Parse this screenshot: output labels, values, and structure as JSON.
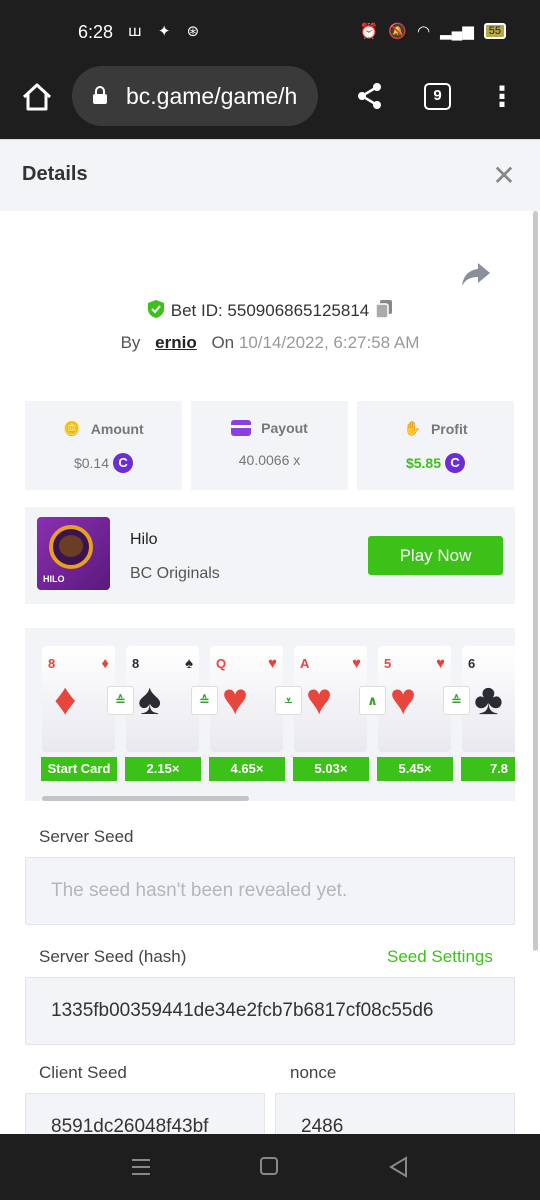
{
  "status_bar": {
    "time": "6:28",
    "app_icons": "ꟺ ✦ ⊛",
    "battery": "55"
  },
  "browser": {
    "url": "bc.game/game/h",
    "tab_count": "9"
  },
  "modal": {
    "title": "Details"
  },
  "bet": {
    "bet_id_text": "Bet ID: 550906865125814",
    "by_label": "By",
    "username": "ernio",
    "on_label": "On",
    "date": "10/14/2022, 6:27:58 AM"
  },
  "stats": {
    "amount_label": "Amount",
    "amount_value": "$0.14",
    "payout_label": "Payout",
    "payout_value": "40.0066 x",
    "profit_label": "Profit",
    "profit_value": "$5.85",
    "coin_symbol": "C"
  },
  "game": {
    "name": "Hilo",
    "provider": "BC Originals",
    "play_label": "Play Now",
    "thumb_text": "HILO"
  },
  "cards": [
    {
      "rank": "8",
      "suit": "♦",
      "color": "#e8453c",
      "mult": "Start Card",
      "arrow": ""
    },
    {
      "rank": "8",
      "suit": "♠",
      "color": "#2b2b33",
      "mult": "2.15×",
      "arrow": "≙"
    },
    {
      "rank": "Q",
      "suit": "♥",
      "color": "#e8453c",
      "mult": "4.65×",
      "arrow": "≙"
    },
    {
      "rank": "A",
      "suit": "♥",
      "color": "#e8453c",
      "mult": "5.03×",
      "arrow": "⩡"
    },
    {
      "rank": "5",
      "suit": "♥",
      "color": "#e8453c",
      "mult": "5.45×",
      "arrow": "∧"
    },
    {
      "rank": "6",
      "suit": "♣",
      "color": "#2b2b33",
      "mult": "7.8",
      "arrow": "≙"
    }
  ],
  "seeds": {
    "server_seed_label": "Server Seed",
    "server_seed_placeholder": "The seed hasn't been revealed yet.",
    "server_hash_label": "Server Seed (hash)",
    "seed_settings_label": "Seed Settings",
    "server_hash_value": "1335fb00359441de34e2fcb7b6817cf08c55d6",
    "client_seed_label": "Client Seed",
    "client_seed_value": "8591dc26048f43bf",
    "nonce_label": "nonce",
    "nonce_value": "2486"
  },
  "colors": {
    "accent_green": "#3bc117",
    "coin_purple": "#6b2dd6",
    "panel_bg": "#f3f4f7"
  }
}
